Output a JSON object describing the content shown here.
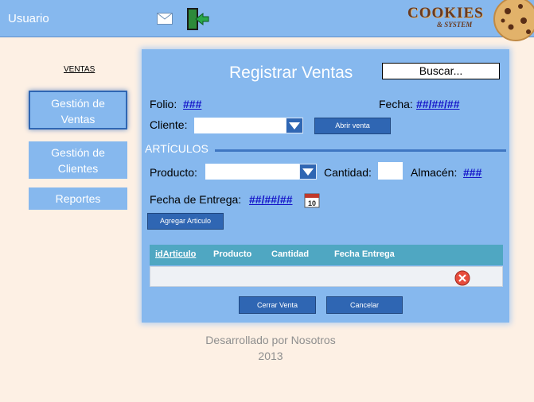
{
  "header": {
    "user_label": "Usuario",
    "icons": [
      "mail-icon",
      "exit-door-icon"
    ],
    "logo_text": "COOKIES",
    "logo_sub": "& SYSTEM"
  },
  "sidebar": {
    "heading": "VENTAS",
    "items": [
      {
        "line1": "Gestión de",
        "line2": "Ventas",
        "active": true
      },
      {
        "line1": "Gestión de",
        "line2": "Clientes",
        "active": false
      },
      {
        "line1": "Reportes",
        "line2": "",
        "active": false
      }
    ]
  },
  "form": {
    "title": "Registrar Ventas",
    "search_label": "Buscar...",
    "folio_label": "Folio:",
    "folio_value": "###",
    "fecha_label": "Fecha:",
    "fecha_value": "##/##/##",
    "cliente_label": "Cliente:",
    "cliente_value": "",
    "abrir_venta_label": "Abrir venta",
    "section_title": "ARTÍCULOS",
    "producto_label": "Producto:",
    "producto_value": "",
    "cantidad_label": "Cantidad:",
    "cantidad_value": "",
    "almacen_label": "Almacén:",
    "almacen_value": "###",
    "fecha_entrega_label": "Fecha de Entrega:",
    "fecha_entrega_value": "##/##/##",
    "calendar_day": "10",
    "agregar_label": "Agregar Articulo",
    "table": {
      "columns": [
        "idArticulo",
        "Producto",
        "Cantidad",
        "Fecha Entrega"
      ]
    },
    "cerrar_label": "Cerrar Venta",
    "cancelar_label": "Cancelar"
  },
  "footer": {
    "line1": "Desarrollado por Nosotros",
    "line2": "2013"
  },
  "colors": {
    "accent": "#86b8ee",
    "dark_button": "#2f66b3",
    "table_header": "#4fa7c2",
    "background": "#fdf0e4"
  }
}
